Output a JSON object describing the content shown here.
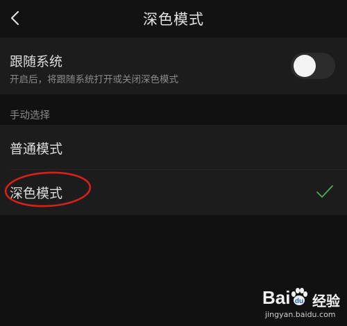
{
  "header": {
    "title": "深色模式",
    "back_icon": "chevron-left-icon"
  },
  "follow_system": {
    "title": "跟随系统",
    "subtitle": "开启后，将跟随系统打开或关闭深色模式",
    "toggle_on": false
  },
  "manual": {
    "section_label": "手动选择",
    "options": [
      {
        "label": "普通模式",
        "selected": false
      },
      {
        "label": "深色模式",
        "selected": true
      }
    ]
  },
  "annotation": {
    "shape": "ellipse",
    "color": "#d6201c"
  },
  "watermark": {
    "logo_text": "Bai",
    "logo_suffix": "经验",
    "url": "jingyan.baidu.com"
  },
  "colors": {
    "background": "#111111",
    "panel": "#1c1c1c",
    "check": "#4caf50",
    "annotation": "#d6201c"
  }
}
